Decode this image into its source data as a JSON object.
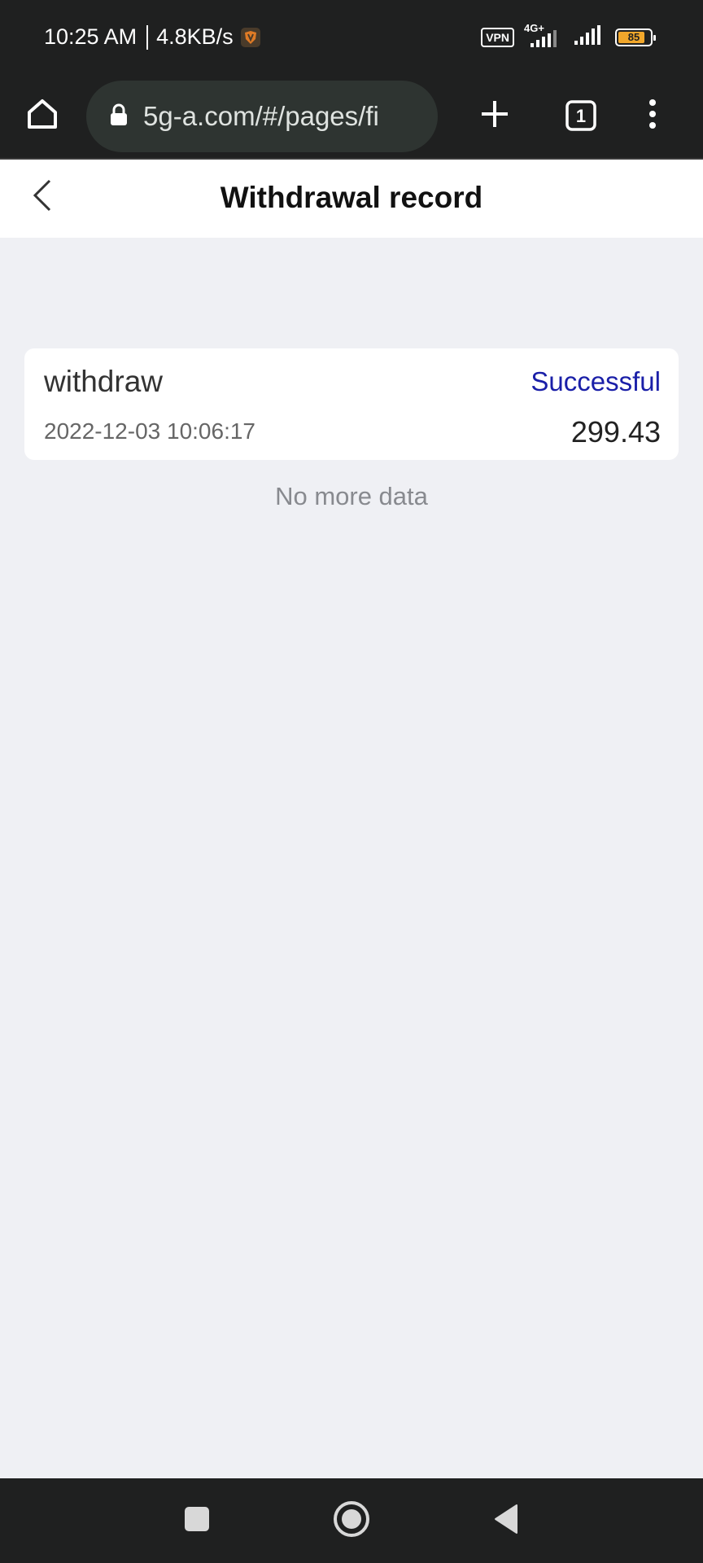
{
  "status_bar": {
    "time": "10:25 AM",
    "speed": "4.8KB/s",
    "vpn": "VPN",
    "network": "4G+",
    "battery": "85",
    "battery_level": 0.85,
    "icons": [
      "app-notification-icon",
      "signal-icon",
      "signal-icon",
      "battery-icon"
    ]
  },
  "browser": {
    "url": "5g-a.com/#/pages/fi",
    "tab_count": "1",
    "icons": [
      "home-icon",
      "lock-icon",
      "plus-icon",
      "tabs-icon",
      "more-vert-icon"
    ]
  },
  "page": {
    "title": "Withdrawal record",
    "back_icon": "chevron-left-icon"
  },
  "records": [
    {
      "type": "withdraw",
      "status": "Successful",
      "date": "2022-12-03 10:06:17",
      "amount": "299.43"
    }
  ],
  "footer_text": "No more data",
  "colors": {
    "status_success": "#1a1fa8",
    "chrome_dark": "#1f2020",
    "page_bg": "#eff0f4"
  },
  "nav": {
    "icons": [
      "recent-apps-icon",
      "home-circle-icon",
      "back-triangle-icon"
    ]
  }
}
